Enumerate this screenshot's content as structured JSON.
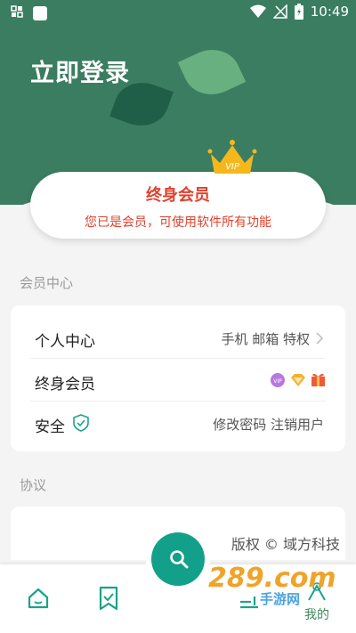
{
  "status_bar": {
    "time": "10:49"
  },
  "header": {
    "title": "立即登录"
  },
  "vip_card": {
    "title": "终身会员",
    "subtitle": "您已是会员，可使用软件所有功能",
    "crown_text": "VIP"
  },
  "sections": [
    {
      "label": "会员中心"
    },
    {
      "label": "协议"
    }
  ],
  "member_rows": [
    {
      "label": "个人中心",
      "value": "手机 邮箱 特权"
    },
    {
      "label": "终身会员",
      "badge": "VIP"
    },
    {
      "label": "安全",
      "value": "修改密码  注销用户"
    }
  ],
  "footer": {
    "copyright": "版权 © 域方科技"
  },
  "tabbar": {
    "active_label": "我的"
  },
  "watermark": {
    "main": "289.com",
    "sub": "手游网"
  },
  "colors": {
    "header": "#3b7d61",
    "accent": "#13a08a",
    "vip": "#e0412d"
  }
}
